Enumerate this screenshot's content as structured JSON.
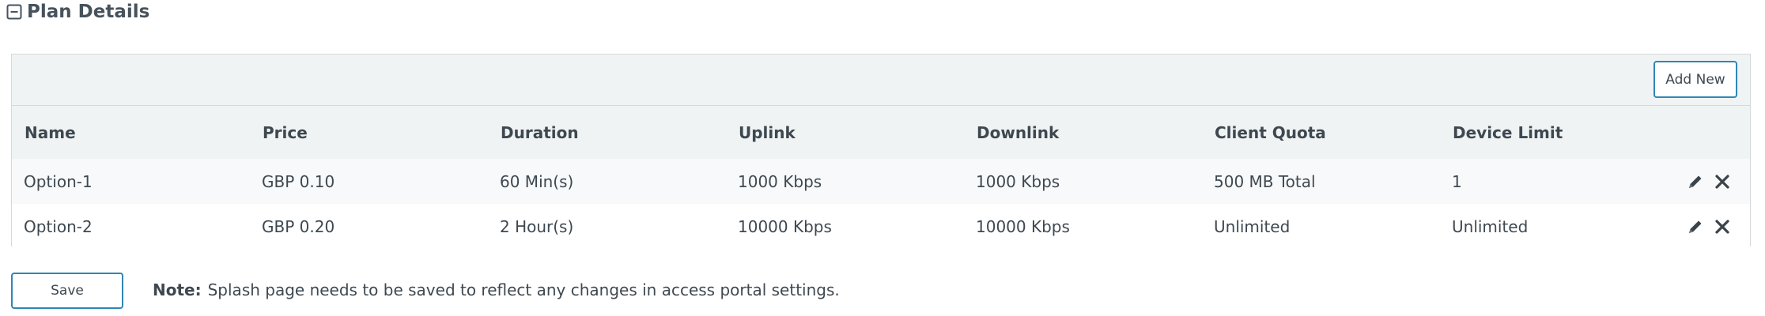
{
  "section": {
    "title": "Plan Details",
    "collapse_icon": "minus-square-icon"
  },
  "toolbar": {
    "add_new_label": "Add New"
  },
  "table": {
    "columns": [
      "Name",
      "Price",
      "Duration",
      "Uplink",
      "Downlink",
      "Client Quota",
      "Device Limit"
    ],
    "rows": [
      [
        "Option-1",
        "GBP 0.10",
        "60 Min(s)",
        "1000 Kbps",
        "1000 Kbps",
        "500 MB Total",
        "1"
      ],
      [
        "Option-2",
        "GBP 0.20",
        "2 Hour(s)",
        "10000 Kbps",
        "10000 Kbps",
        "Unlimited",
        "Unlimited"
      ]
    ],
    "row_actions": [
      "pencil-icon",
      "close-icon"
    ]
  },
  "footer": {
    "save_label": "Save",
    "note_label": "Note:",
    "note_text": "Splash page needs to be saved to reflect any changes in access portal settings."
  },
  "colors": {
    "accent": "#2f86b4",
    "header_bg": "#f0f3f4",
    "border": "#d4d9dc",
    "text": "#3e4850"
  }
}
